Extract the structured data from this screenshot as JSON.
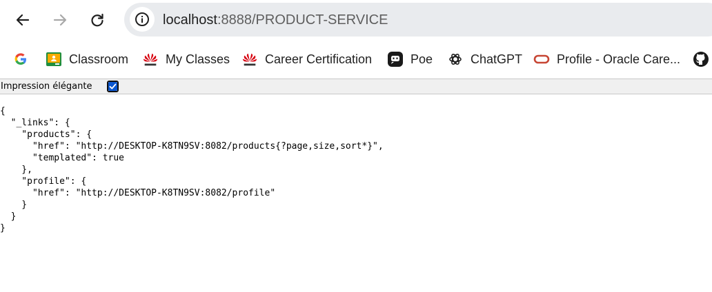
{
  "browser": {
    "back_icon": "arrow-left-icon",
    "forward_icon": "arrow-right-icon",
    "reload_icon": "reload-icon",
    "site_info_icon": "info-icon",
    "url_host": "localhost",
    "url_path": ":8888/PRODUCT-SERVICE"
  },
  "bookmarks": [
    {
      "label": "",
      "icon": "google-icon"
    },
    {
      "label": "Classroom",
      "icon": "classroom-icon"
    },
    {
      "label": "My Classes",
      "icon": "huawei-icon"
    },
    {
      "label": "Career Certification",
      "icon": "huawei-icon"
    },
    {
      "label": "Poe",
      "icon": "poe-icon"
    },
    {
      "label": "ChatGPT",
      "icon": "chatgpt-icon"
    },
    {
      "label": "Profile - Oracle Care...",
      "icon": "oracle-icon"
    },
    {
      "label": "",
      "icon": "github-icon"
    }
  ],
  "pretty_print": {
    "label": "Impression élégante",
    "checked": true
  },
  "json_lines": [
    "{",
    "  \"_links\": {",
    "    \"products\": {",
    "      \"href\": \"http://DESKTOP-K8TN9SV:8082/products{?page,size,sort*}\",",
    "      \"templated\": true",
    "    },",
    "    \"profile\": {",
    "      \"href\": \"http://DESKTOP-K8TN9SV:8082/profile\"",
    "    }",
    "  }",
    "}"
  ],
  "colors": {
    "omnibox_bg": "#e9ebee",
    "checkbox_blue": "#0b57d0",
    "huawei_red": "#d7000f",
    "oracle_red": "#c74634"
  }
}
